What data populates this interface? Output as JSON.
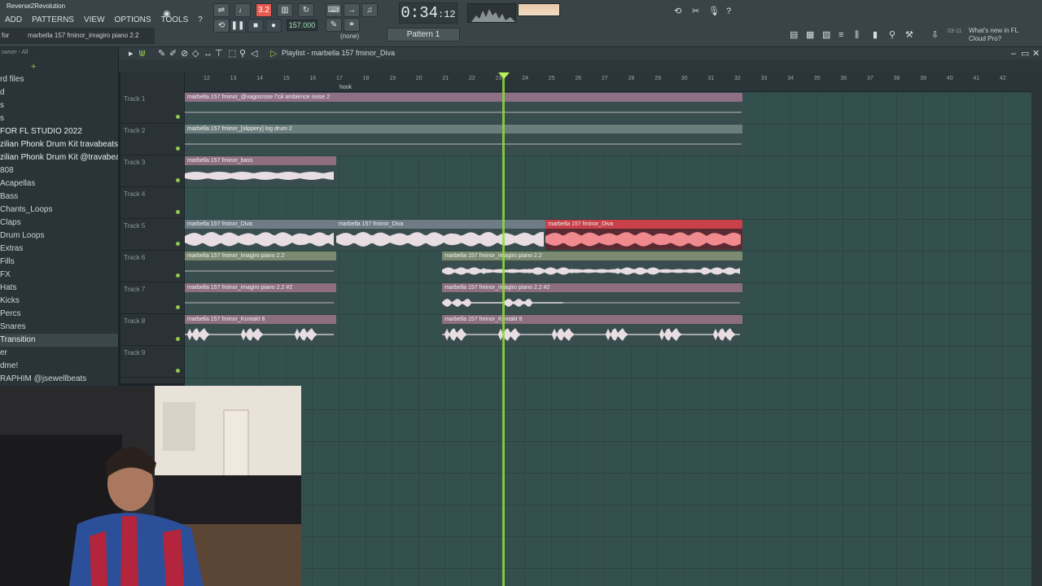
{
  "app": {
    "project_title": "Reverse2Revolution"
  },
  "menu": [
    "ADD",
    "PATTERNS",
    "VIEW",
    "OPTIONS",
    "TOOLS",
    "?"
  ],
  "hint": {
    "left": "for",
    "right": "marbella 157 fminor_imagiro piano 2.2"
  },
  "transport": {
    "time": "0:34",
    "time_small": ":12",
    "tempo": "157.000",
    "pattern": "Pattern 1",
    "none_label": "(none)",
    "rec_mode": "3.2"
  },
  "news": {
    "date": "03-11",
    "text": "What's new in FL Cloud Pro?"
  },
  "browser": {
    "header": "owser - All",
    "items": [
      {
        "label": "rd files"
      },
      {
        "label": "d"
      },
      {
        "label": "s"
      },
      {
        "label": "s"
      },
      {
        "label": " FOR FL STUDIO 2022",
        "bold": true
      },
      {
        "label": "zilian Phonk Drum Kit travabeats (1)",
        "bold": true
      },
      {
        "label": "zilian Phonk Drum Kit @travabeats",
        "bold": true
      },
      {
        "label": "808"
      },
      {
        "label": "Acapellas"
      },
      {
        "label": "Bass"
      },
      {
        "label": "Chants_Loops"
      },
      {
        "label": "Claps"
      },
      {
        "label": "Drum Loops"
      },
      {
        "label": "Extras"
      },
      {
        "label": "Fills"
      },
      {
        "label": "FX"
      },
      {
        "label": "Hats"
      },
      {
        "label": "Kicks"
      },
      {
        "label": "Percs"
      },
      {
        "label": "Snares"
      },
      {
        "label": "Transition",
        "selected": true
      },
      {
        "label": "er"
      },
      {
        "label": "dme!"
      },
      {
        "label": "RAPHIM @jsewellbeats"
      }
    ]
  },
  "playlist": {
    "title": "Playlist - marbella 157 fminor_Diva",
    "ruler_marks": [
      "12",
      "13",
      "14",
      "15",
      "16",
      "17",
      "18",
      "19",
      "20",
      "21",
      "22",
      "23",
      "24",
      "25",
      "26",
      "27",
      "28",
      "29",
      "30",
      "31",
      "32",
      "33",
      "34",
      "35",
      "36",
      "37",
      "38",
      "39",
      "40",
      "41",
      "42"
    ],
    "marker_label": "hook",
    "tracks": [
      "Track 1",
      "Track 2",
      "Track 3",
      "Track 4",
      "Track 5",
      "Track 6",
      "Track 7",
      "Track 8",
      "Track 9"
    ],
    "clips": [
      {
        "name": "marbella 157 fminor_@vagosrose Гсй ambience noise 2",
        "track": 0,
        "start": 0.0,
        "end": 21.0,
        "color": "#8f6f85",
        "body": "#3a4d4e",
        "wave": "line"
      },
      {
        "name": "marbella 157 fminor_[slippery] log drum 2",
        "track": 1,
        "start": 0.0,
        "end": 21.0,
        "color": "#6c7e7c",
        "body": "#3a4d4e",
        "wave": "line"
      },
      {
        "name": "marbella 157 fminor_bass",
        "track": 2,
        "start": 0.0,
        "end": 5.7,
        "color": "#8e6f80",
        "body": "#3a4d4e",
        "wave": "bass"
      },
      {
        "name": "marbella 157 fminor_Diva",
        "track": 4,
        "start": 0.0,
        "end": 5.7,
        "color": "#6e7c86",
        "body": "#3a4d4e",
        "wave": "dense"
      },
      {
        "name": "marbella 157 fminor_Diva",
        "track": 4,
        "start": 5.7,
        "end": 13.6,
        "color": "#6e7c86",
        "body": "#3a4d4e",
        "wave": "dense"
      },
      {
        "name": "marbella 157 fminor_Diva",
        "track": 4,
        "start": 13.6,
        "end": 21.0,
        "color": "#c8404a",
        "body": "#5a2a32",
        "wave": "dense-red"
      },
      {
        "name": "marbella 157 fminor_imagiro piano 2.2",
        "track": 5,
        "start": 0.0,
        "end": 5.7,
        "color": "#7b8a70",
        "body": "#3a4d4e",
        "wave": "line"
      },
      {
        "name": "marbella 157 fminor_imagiro piano 2.2",
        "track": 5,
        "start": 9.7,
        "end": 21.0,
        "color": "#7b8a70",
        "body": "#3a4d4e",
        "wave": "sparse"
      },
      {
        "name": "marbella 157 fminor_imagiro piano 2.2 #2",
        "track": 6,
        "start": 0.0,
        "end": 5.7,
        "color": "#8e6f80",
        "body": "#3a4d4e",
        "wave": "line"
      },
      {
        "name": "marbella 157 fminor_imagiro piano 2.2 #2",
        "track": 6,
        "start": 9.7,
        "end": 21.0,
        "color": "#8e6f80",
        "body": "#3a4d4e",
        "wave": "blips"
      },
      {
        "name": "marbella 157 fminor_Kontakt 8",
        "track": 7,
        "start": 0.0,
        "end": 5.7,
        "color": "#8e6f80",
        "body": "#3a4d4e",
        "wave": "bursts"
      },
      {
        "name": "marbella 157 fminor_Kontakt 8",
        "track": 7,
        "start": 9.7,
        "end": 21.0,
        "color": "#8e6f80",
        "body": "#3a4d4e",
        "wave": "bursts"
      }
    ]
  },
  "colors": {
    "accent_green": "#8fdc3c",
    "record_red": "#e85a4f"
  },
  "icons": [
    "playlist-icon",
    "piano-roll-icon",
    "channel-rack-icon",
    "mixer-icon",
    "plugin-icon",
    "browser-icon",
    "cloud-icon"
  ]
}
